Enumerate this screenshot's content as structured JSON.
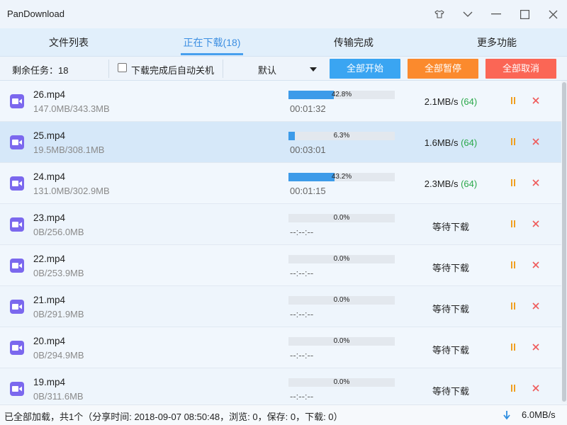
{
  "app": {
    "title": "PanDownload"
  },
  "tabs": [
    {
      "label": "文件列表",
      "active": false
    },
    {
      "label": "正在下载(18)",
      "active": true
    },
    {
      "label": "传输完成",
      "active": false
    },
    {
      "label": "更多功能",
      "active": false
    }
  ],
  "toolbar": {
    "remaining": "剩余任务：18",
    "auto_shutdown_label": "下载完成后自动关机",
    "auto_shutdown_checked": false,
    "sort_value": "默认",
    "start_all": "全部开始",
    "pause_all": "全部暂停",
    "cancel_all": "全部取消"
  },
  "colors": {
    "accent": "#48a0ee",
    "start_all": "#3aa5f2",
    "pause_all": "#fb8a2d",
    "cancel_all": "#fb6655",
    "file_icon": "#7b68ee",
    "pause_icon": "#f0a020",
    "close_icon": "#ef5a5a",
    "connections": "#2aa84a"
  },
  "downloads": [
    {
      "name": "26.mp4",
      "size": "147.0MB/343.3MB",
      "progress": 0.428,
      "percent": "42.8%",
      "time": "00:01:32",
      "speed": "2.1MB/s",
      "connections": "(64)",
      "status": ""
    },
    {
      "name": "25.mp4",
      "size": "19.5MB/308.1MB",
      "progress": 0.063,
      "percent": "6.3%",
      "time": "00:03:01",
      "speed": "1.6MB/s",
      "connections": "(64)",
      "status": "",
      "selected": true
    },
    {
      "name": "24.mp4",
      "size": "131.0MB/302.9MB",
      "progress": 0.432,
      "percent": "43.2%",
      "time": "00:01:15",
      "speed": "2.3MB/s",
      "connections": "(64)",
      "status": ""
    },
    {
      "name": "23.mp4",
      "size": "0B/256.0MB",
      "progress": 0.0,
      "percent": "0.0%",
      "time": "--:--:--",
      "speed": "",
      "connections": "",
      "status": "等待下载"
    },
    {
      "name": "22.mp4",
      "size": "0B/253.9MB",
      "progress": 0.0,
      "percent": "0.0%",
      "time": "--:--:--",
      "speed": "",
      "connections": "",
      "status": "等待下载"
    },
    {
      "name": "21.mp4",
      "size": "0B/291.9MB",
      "progress": 0.0,
      "percent": "0.0%",
      "time": "--:--:--",
      "speed": "",
      "connections": "",
      "status": "等待下载"
    },
    {
      "name": "20.mp4",
      "size": "0B/294.9MB",
      "progress": 0.0,
      "percent": "0.0%",
      "time": "--:--:--",
      "speed": "",
      "connections": "",
      "status": "等待下载"
    },
    {
      "name": "19.mp4",
      "size": "0B/311.6MB",
      "progress": 0.0,
      "percent": "0.0%",
      "time": "--:--:--",
      "speed": "",
      "connections": "",
      "status": "等待下载"
    }
  ],
  "status": {
    "text": "已全部加载，共1个（分享时间: 2018-09-07 08:50:48，浏览: 0，保存: 0，下载: 0）",
    "total_speed": "6.0MB/s"
  }
}
